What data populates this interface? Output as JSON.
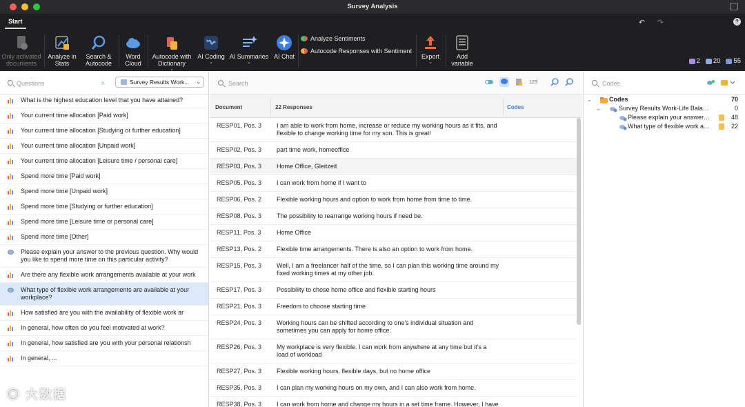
{
  "window": {
    "title": "Survey Analysis"
  },
  "ribbon": {
    "tab": "Start",
    "buttons": [
      {
        "label1": "Only activated",
        "label2": "documents",
        "icon": "documents-icon"
      },
      {
        "label1": "Analyze in",
        "label2": "Stats",
        "icon": "stats-icon"
      },
      {
        "label1": "Search &",
        "label2": "Autocode",
        "icon": "search-icon"
      },
      {
        "label1": "Word",
        "label2": "Cloud",
        "icon": "cloud-icon"
      },
      {
        "label1": "Autocode with",
        "label2": "Dictionary",
        "icon": "dictionary-icon"
      },
      {
        "label1": "AI Coding",
        "label2": "",
        "icon": "ai-coding-icon"
      },
      {
        "label1": "AI Summaries",
        "label2": "",
        "icon": "ai-summaries-icon"
      },
      {
        "label1": "AI Chat",
        "label2": "",
        "icon": "ai-chat-icon"
      },
      {
        "label1": "Export",
        "label2": "",
        "icon": "export-icon"
      },
      {
        "label1": "Add",
        "label2": "variable",
        "icon": "add-variable-icon"
      }
    ],
    "analyze_sentiments": "Analyze Sentiments",
    "autocode_sentiment": "Autocode Responses with Sentiment",
    "counters": [
      "2",
      "20",
      "55"
    ]
  },
  "left": {
    "search_placeholder": "Questions",
    "dropdown": "Survey Results Work...",
    "questions": [
      {
        "text": "What is the highest education level that you have attained?",
        "type": "closed"
      },
      {
        "text": "Your current time allocation [Paid work]",
        "type": "closed"
      },
      {
        "text": "Your current time allocation [Studying or further education]",
        "type": "closed"
      },
      {
        "text": "Your current time allocation [Unpaid work]",
        "type": "closed"
      },
      {
        "text": "Your current time allocation [Leisure time / personal care]",
        "type": "closed"
      },
      {
        "text": "Spend more time [Paid work]",
        "type": "closed"
      },
      {
        "text": "Spend more time [Unpaid work]",
        "type": "closed"
      },
      {
        "text": "Spend more time [Studying or further education]",
        "type": "closed"
      },
      {
        "text": "Spend more time [Leisure time or personal care]",
        "type": "closed"
      },
      {
        "text": "Spend more time [Other]",
        "type": "closed"
      },
      {
        "text": "Please explain your answer to the previous question. Why would you like to spend more time on this particular activity?",
        "type": "open"
      },
      {
        "text": "Are there any flexible work arrangements available at your work",
        "type": "closed"
      },
      {
        "text": "What type of flexible work arrangements are available at your workplace?",
        "type": "open",
        "selected": true
      },
      {
        "text": "How satisfied are you with the availability of flexible work ar",
        "type": "closed"
      },
      {
        "text": "In general, how often do you feel motivated at work?",
        "type": "closed"
      },
      {
        "text": "In general, how satisfied are you with your personal relationsh",
        "type": "closed"
      },
      {
        "text": "In general, ...",
        "type": "closed"
      }
    ]
  },
  "center": {
    "search_placeholder": "Search",
    "tool_123": "123",
    "col_document": "Document",
    "col_responses": "22 Responses",
    "col_codes": "Codes",
    "rows": [
      {
        "doc": "RESP01, Pos. 3",
        "text": "I am able to work from home, increase or reduce my working hours as it fits, and flexible to change working time for my son. This is great!"
      },
      {
        "doc": "RESP02, Pos. 3",
        "text": "part time work, homeoffice"
      },
      {
        "doc": "RESP03, Pos. 3",
        "text": "Home Office, Gleitzeit"
      },
      {
        "doc": "RESP05, Pos. 3",
        "text": "I can work from home if I want to"
      },
      {
        "doc": "RESP06, Pos. 2",
        "text": "Flexible working hours and option to work from home from time to time."
      },
      {
        "doc": "RESP08, Pos. 3",
        "text": "The possibility to rearrange working hours if need be."
      },
      {
        "doc": "RESP11, Pos. 3",
        "text": "Home Office"
      },
      {
        "doc": "RESP13, Pos. 2",
        "text": "Flexible time arrangements. There is also an option to work from home."
      },
      {
        "doc": "RESP15, Pos. 3",
        "text": "Well, I am a freelancer half of the time, so I can plan this working time around my fixed working times at my other job."
      },
      {
        "doc": "RESP17, Pos. 3",
        "text": "Possibility to chose home office and flexible starting hours"
      },
      {
        "doc": "RESP21, Pos. 3",
        "text": "Freedom to choose starting time"
      },
      {
        "doc": "RESP24, Pos. 3",
        "text": "Working hours can be shifted according to one's individual situation and sometimes you can apply for home office."
      },
      {
        "doc": "RESP26, Pos. 3",
        "text": "My workplace is very flexible. I can work from anywhere at any time but it's a load of workload"
      },
      {
        "doc": "RESP27, Pos. 3",
        "text": "Flexible working hours, flexible days, but no home office"
      },
      {
        "doc": "RESP35, Pos. 3",
        "text": "I can plan my working hours on my own, and I can also work from home."
      },
      {
        "doc": "RESP38, Pos. 3",
        "text": "I can work from home and change my hours in a set time frame. However, I have a lot of appointments in the evening which I cannot move."
      }
    ]
  },
  "right": {
    "search_placeholder": "Codes",
    "root_label": "Codes",
    "root_count": "70",
    "set_label": "Survey Results Work-Life Balan...",
    "set_count": "0",
    "children": [
      {
        "label": "Please explain your answer ...",
        "count": "48"
      },
      {
        "label": "What type of flexible work a...",
        "count": "22"
      }
    ]
  },
  "colors": {
    "accent": "#2f6fd6",
    "selected_row": "#dce9fb",
    "ribbon_bg": "#1f1f21"
  }
}
